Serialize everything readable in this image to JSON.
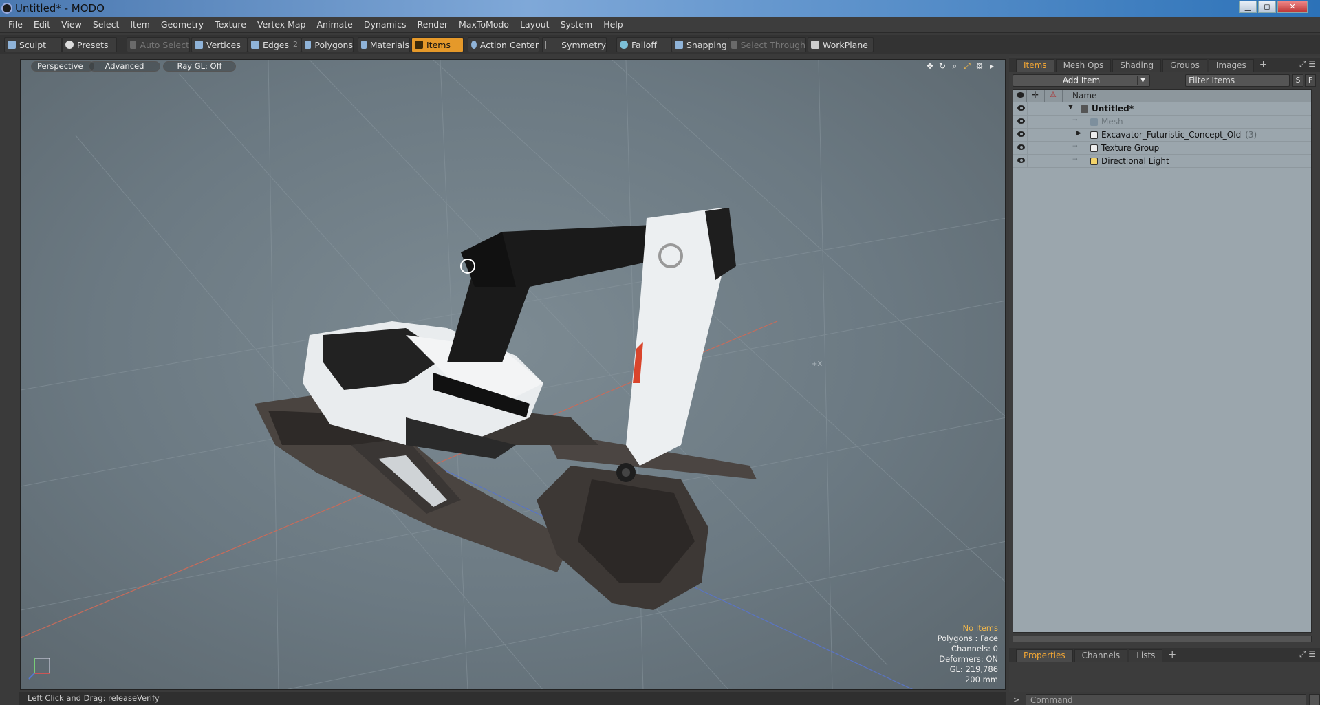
{
  "window": {
    "title": "Untitled* - MODO",
    "minimize": "▁",
    "maximize": "◻",
    "close": "✕"
  },
  "menu": [
    "File",
    "Edit",
    "View",
    "Select",
    "Item",
    "Geometry",
    "Texture",
    "Vertex Map",
    "Animate",
    "Dynamics",
    "Render",
    "MaxToModo",
    "Layout",
    "System",
    "Help"
  ],
  "toolbar": {
    "sculpt": "Sculpt",
    "presets": "Presets",
    "auto_select": "Auto Select",
    "vertices": "Vertices",
    "edges": "Edges",
    "edges_count": "2",
    "polygons": "Polygons",
    "materials": "Materials",
    "items": "Items",
    "action_center": "Action Center",
    "symmetry": "Symmetry",
    "falloff": "Falloff",
    "snapping": "Snapping",
    "select_through": "Select Through",
    "workplane": "WorkPlane"
  },
  "viewport": {
    "view": "Perspective",
    "mode": "Advanced",
    "raygl": "Ray GL: Off",
    "stats": {
      "no_items": "No Items",
      "polygons": "Polygons : Face",
      "channels": "Channels: 0",
      "deformers": "Deformers: ON",
      "gl": "GL: 219,786",
      "grid": "200 mm"
    }
  },
  "items_panel": {
    "tabs": [
      "Items",
      "Mesh Ops",
      "Shading",
      "Groups",
      "Images"
    ],
    "add_item": "Add Item",
    "filter_placeholder": "Filter Items",
    "btn_s": "S",
    "btn_f": "F",
    "column_name": "Name",
    "rows": [
      {
        "label": "Untitled*",
        "count": "",
        "level": 0
      },
      {
        "label": "Mesh",
        "count": "",
        "level": 1
      },
      {
        "label": "Excavator_Futuristic_Concept_Old",
        "count": "(3)",
        "level": 1
      },
      {
        "label": "Texture Group",
        "count": "",
        "level": 1
      },
      {
        "label": "Directional Light",
        "count": "",
        "level": 1
      }
    ]
  },
  "properties_panel": {
    "tabs": [
      "Properties",
      "Channels",
      "Lists"
    ],
    "command_placeholder": "Command"
  },
  "statusbar": {
    "text": "Left Click and Drag:  releaseVerify"
  },
  "colors": {
    "accent": "#e5992a",
    "viewport_bg": "#6b7982",
    "tree_bg": "#9ba6ad"
  }
}
